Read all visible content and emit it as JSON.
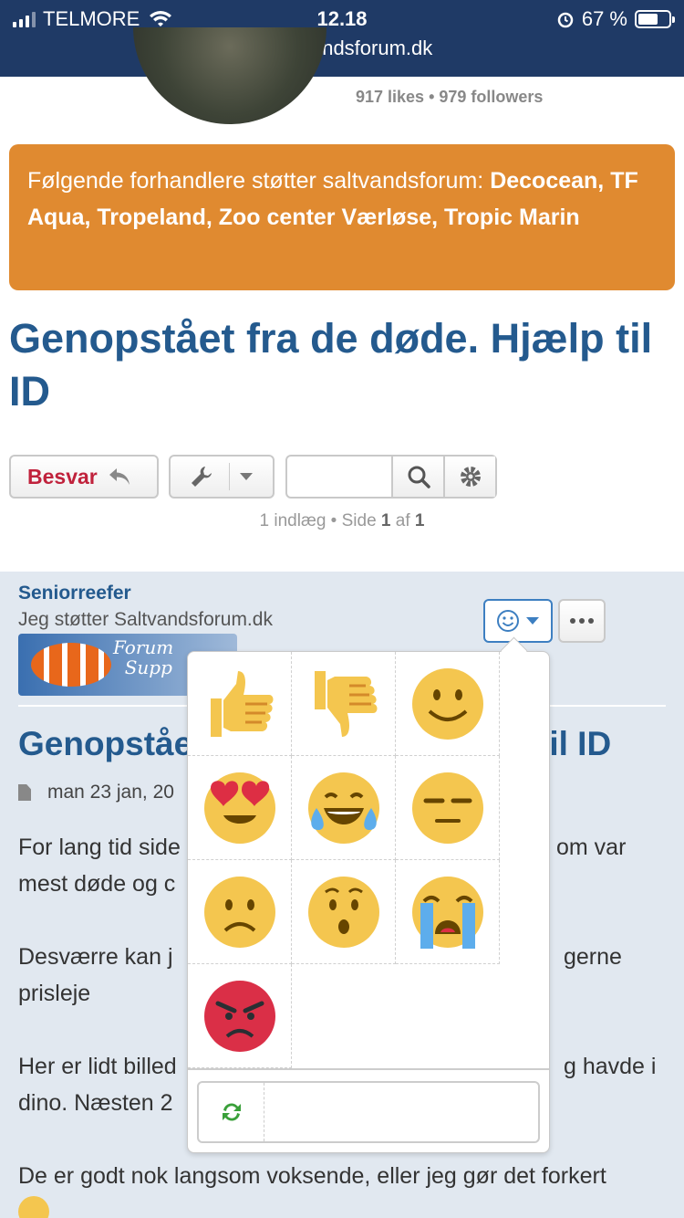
{
  "status_bar": {
    "carrier": "TELMORE",
    "time": "12.18",
    "battery": "67 %",
    "url": "saltvandsforum.dk"
  },
  "profile": {
    "stats": "917 likes • 979 followers"
  },
  "banner": {
    "intro": "Følgende forhandlere støtter saltvandsforum: ",
    "dealers": "Decocean, TF Aqua, Tropeland, Zoo center Værløse, Tropic Marin"
  },
  "topic": {
    "title": "Genopstået fra de døde. Hjælp til ID"
  },
  "toolbar": {
    "reply_label": "Besvar",
    "search_placeholder": ""
  },
  "pagination": {
    "count_text": "1 indlæg • Side ",
    "page": "1",
    "of_text": " af ",
    "total": "1"
  },
  "post": {
    "author": "Seniorreefer",
    "rank": "Jeg støtter Saltvandsforum.dk",
    "support_image_text_1": "Forum",
    "support_image_text_2": "Supp",
    "title": "Genopståe",
    "title_end": "til ID",
    "date": "man 23 jan, 20",
    "p1_a": "For lang tid side",
    "p1_b": "om var",
    "p1_c": "mest døde og c",
    "p2_a": "Desværre kan j",
    "p2_b": "gerne",
    "p2_c": "prisleje",
    "p3_a": "Her er lidt billed",
    "p3_b": "g havde i",
    "p3_c": "dino. Næsten 2",
    "p4": "De er godt nok langsom voksende, eller jeg gør det forkert"
  },
  "reactions": [
    "thumbs-up",
    "thumbs-down",
    "smile",
    "heart-eyes",
    "tears-of-joy",
    "neutral-face",
    "frowning-face",
    "hushed-face",
    "loudly-crying-face",
    "angry-face"
  ],
  "colors": {
    "header": "#1f3a66",
    "banner": "#e08a30",
    "title": "#245a8e",
    "reply": "#c0223c",
    "post_bg": "#e1e8f0"
  }
}
